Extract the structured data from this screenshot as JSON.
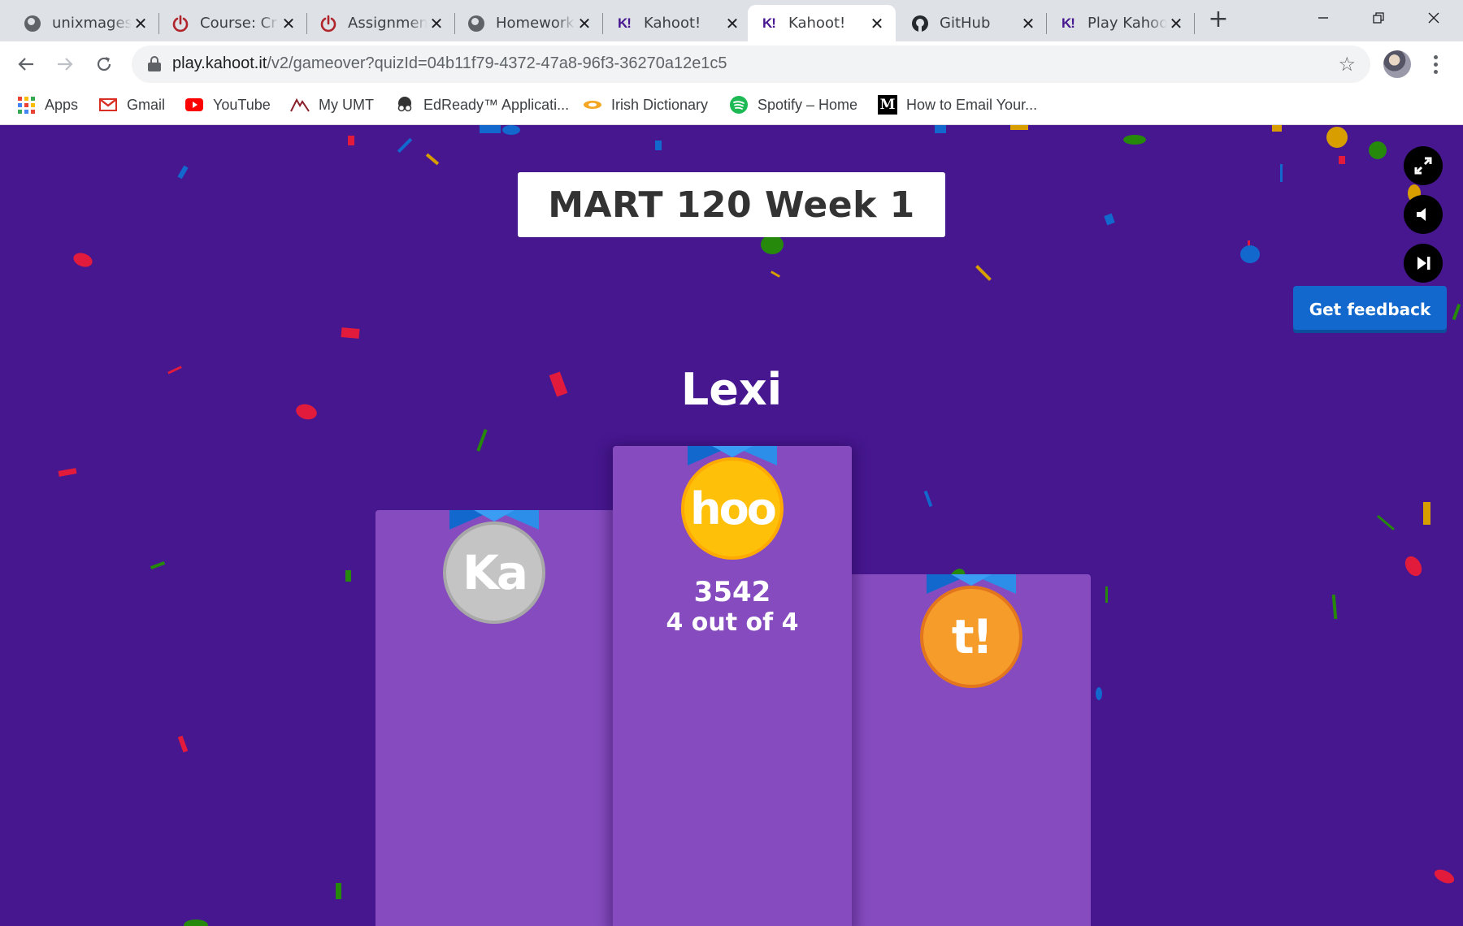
{
  "browser": {
    "tabs": [
      {
        "title": "unixmages",
        "icon": "globe-icon"
      },
      {
        "title": "Course: Cr",
        "icon": "power-icon"
      },
      {
        "title": "Assignmen",
        "icon": "power-icon"
      },
      {
        "title": "Homework",
        "icon": "globe-icon"
      },
      {
        "title": "Kahoot!",
        "icon": "kahoot-icon"
      },
      {
        "title": "Kahoot!",
        "icon": "kahoot-icon",
        "active": true
      },
      {
        "title": "GitHub",
        "icon": "github-icon"
      },
      {
        "title": "Play Kahoo",
        "icon": "kahoot-icon"
      }
    ],
    "new_tab_symbol": "+",
    "close_symbol": "✕",
    "url": {
      "host": "play.kahoot.it",
      "path": "/v2/gameover?quizId=04b11f79-4372-47a8-96f3-36270a12e1c5"
    },
    "bookmarks": [
      {
        "label": "Apps",
        "icon": "apps-grid-icon"
      },
      {
        "label": "Gmail",
        "icon": "gmail-icon"
      },
      {
        "label": "YouTube",
        "icon": "youtube-icon"
      },
      {
        "label": "My UMT",
        "icon": "umt-icon"
      },
      {
        "label": "EdReady™ Applicati...",
        "icon": "edready-icon"
      },
      {
        "label": "Irish Dictionary",
        "icon": "dictionary-icon"
      },
      {
        "label": "Spotify – Home",
        "icon": "spotify-icon"
      },
      {
        "label": "How to Email Your...",
        "icon": "medium-icon"
      }
    ],
    "medium_letter": "M",
    "kahoot_favicon_text": "K!"
  },
  "game": {
    "quiz_title": "MART 120 Week 1",
    "winner_name": "Lexi",
    "feedback_button": "Get feedback",
    "podium": {
      "first": {
        "medal_text": "hoo",
        "score": "3542",
        "correct": "4 out of 4"
      },
      "second": {
        "medal_text": "Ka"
      },
      "third": {
        "medal_text": "t!"
      }
    },
    "colors": {
      "background": "#46178f",
      "podium": "#864cbf",
      "gold": "#ffc00a",
      "silver": "#c4c4c4",
      "bronze": "#f59c2b",
      "feedback": "#1368ce"
    },
    "controls": [
      "fullscreen-icon",
      "volume-icon",
      "skip-icon"
    ]
  }
}
